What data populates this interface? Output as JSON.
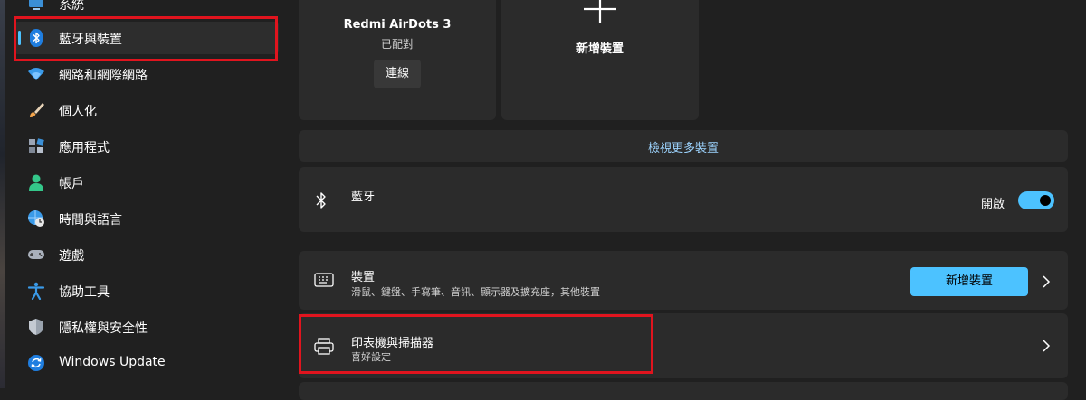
{
  "sidebar": {
    "items": [
      {
        "label": "系統",
        "icon": "system-icon"
      },
      {
        "label": "藍牙與裝置",
        "icon": "bluetooth-icon",
        "active": true
      },
      {
        "label": "網路和網際網路",
        "icon": "wifi-icon"
      },
      {
        "label": "個人化",
        "icon": "brush-icon"
      },
      {
        "label": "應用程式",
        "icon": "apps-icon"
      },
      {
        "label": "帳戶",
        "icon": "account-icon"
      },
      {
        "label": "時間與語言",
        "icon": "globe-clock-icon"
      },
      {
        "label": "遊戲",
        "icon": "gamepad-icon"
      },
      {
        "label": "協助工具",
        "icon": "accessibility-icon"
      },
      {
        "label": "隱私權與安全性",
        "icon": "shield-icon"
      },
      {
        "label": "Windows Update",
        "icon": "update-icon"
      }
    ]
  },
  "device_card": {
    "name": "Redmi AirDots 3",
    "status": "已配對",
    "connect_label": "連線"
  },
  "add_device_card": {
    "label": "新增裝置"
  },
  "view_more": {
    "label": "檢視更多裝置"
  },
  "bluetooth_row": {
    "title": "藍牙",
    "toggle_label": "開啟",
    "toggle_on": true
  },
  "devices_row": {
    "title": "裝置",
    "subtitle": "滑鼠、鍵盤、手寫筆、音訊、顯示器及擴充座，其他裝置",
    "add_button": "新增裝置"
  },
  "printers_row": {
    "title": "印表機與掃描器",
    "subtitle": "喜好設定"
  },
  "colors": {
    "accent": "#4cc2ff",
    "highlight": "#e0141e",
    "background": "#202020",
    "card": "#2b2b2b"
  }
}
